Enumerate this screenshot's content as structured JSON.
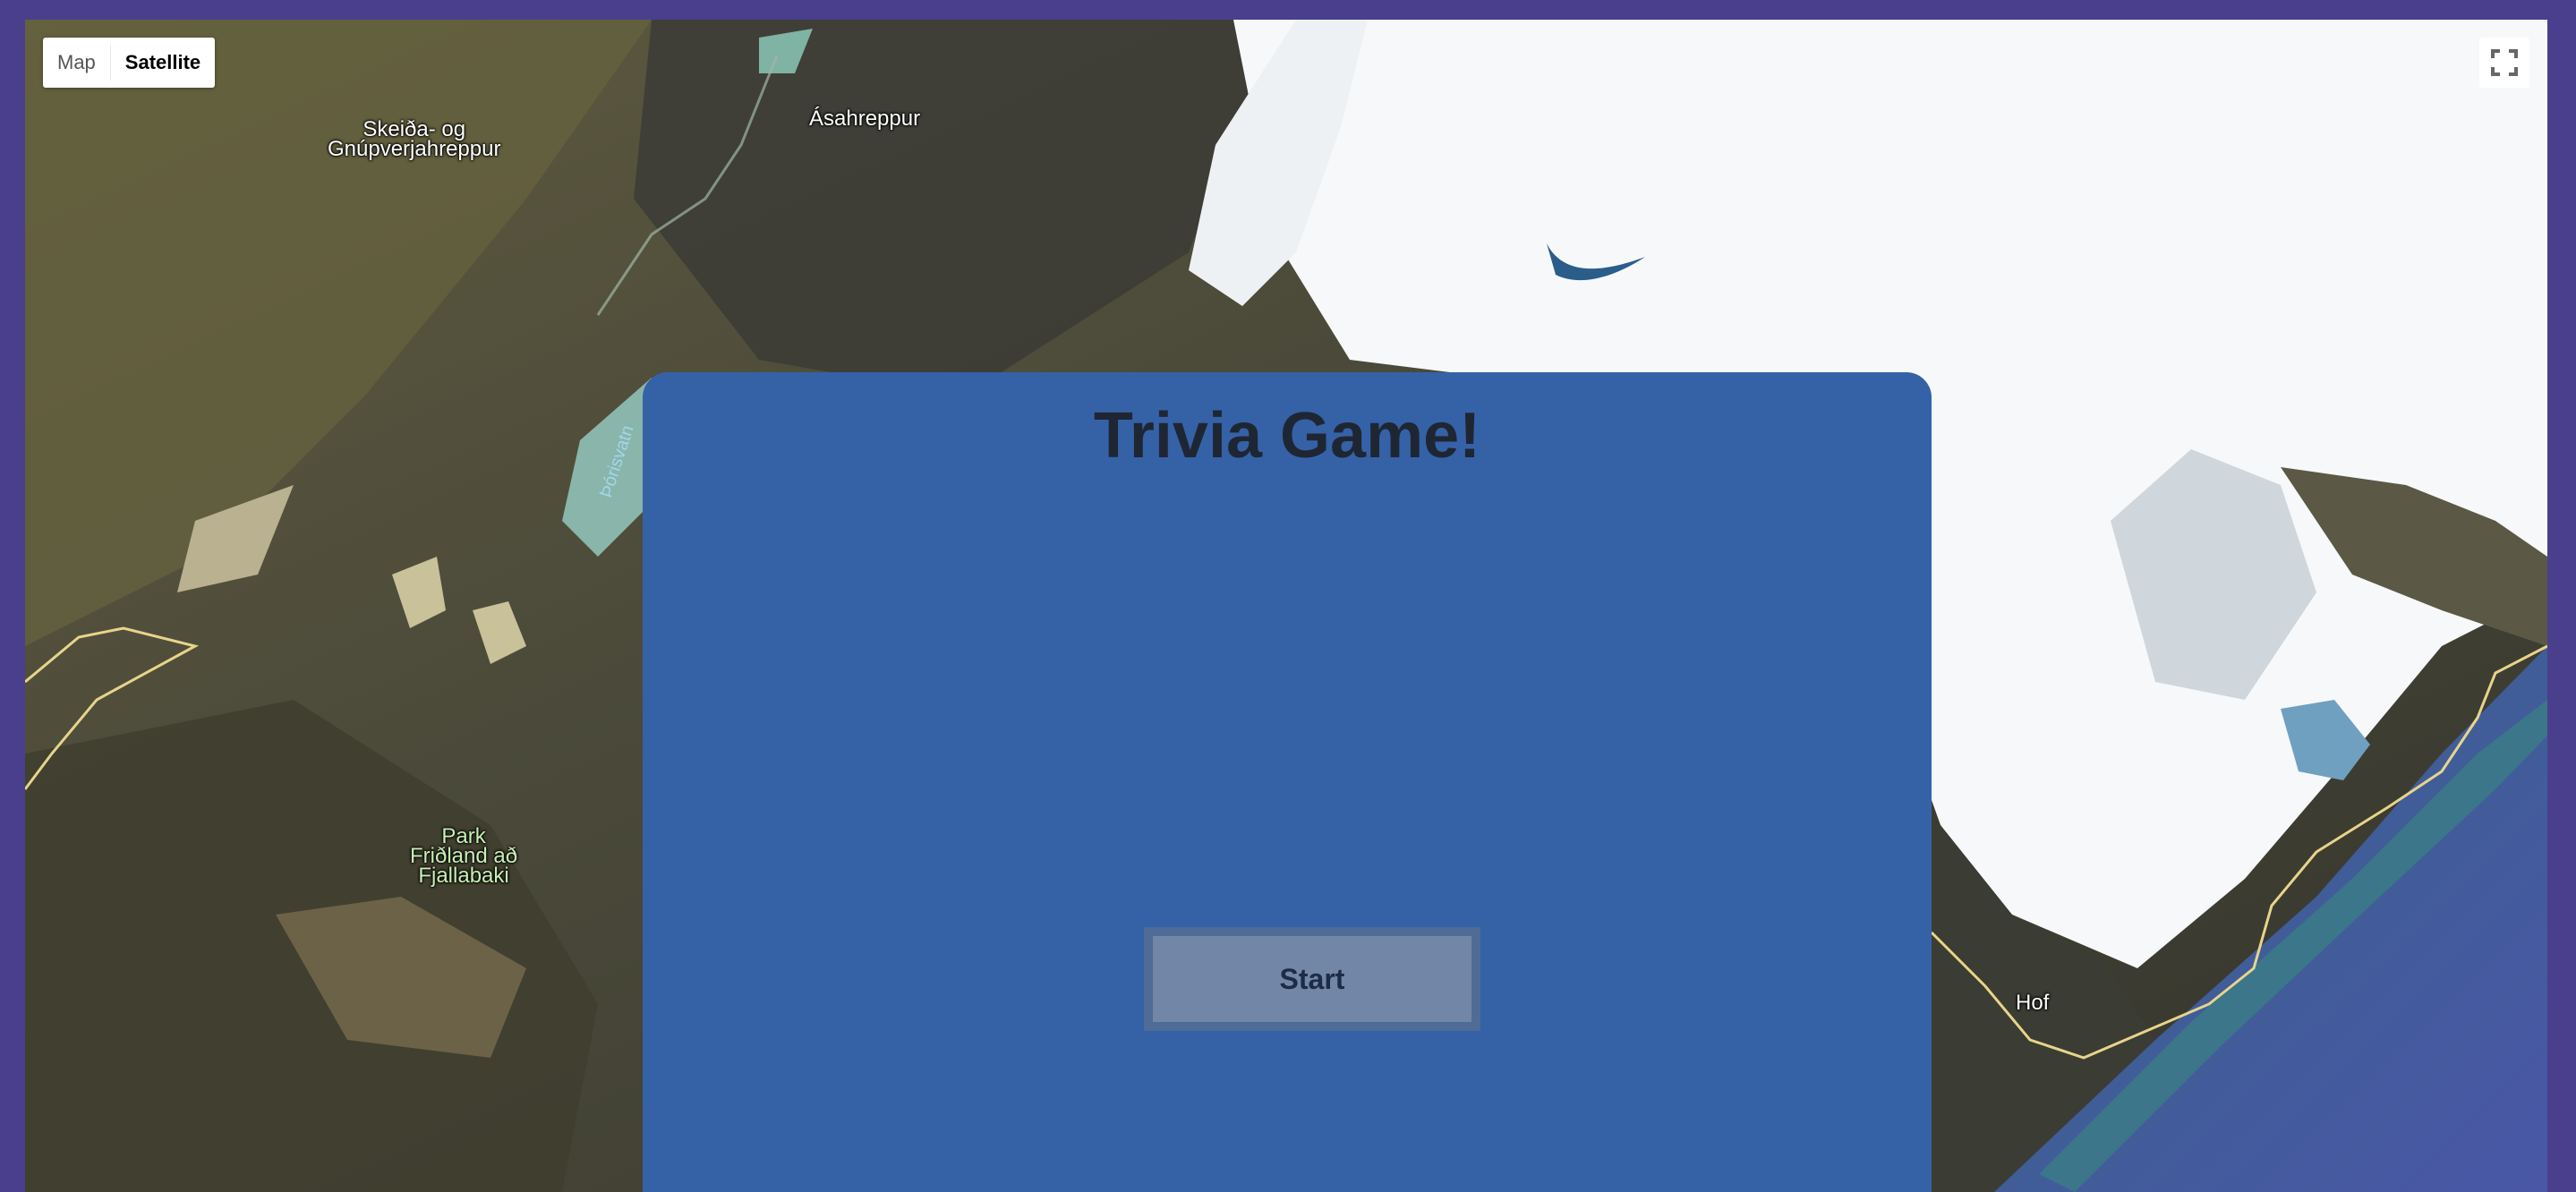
{
  "map": {
    "type_control": {
      "map_label": "Map",
      "satellite_label": "Satellite",
      "selected": "Satellite"
    },
    "fullscreen_icon": "fullscreen-icon",
    "places": {
      "skeida_line1": "Skeiða- og",
      "skeida_line2": "Gnúpverjahreppur",
      "asahreppur": "Ásahreppur",
      "park_line1": "Park",
      "park_line2": "Friðland að",
      "park_line3": "Fjallabaki",
      "hof": "Hof",
      "lake": "Þórisvatn"
    }
  },
  "trivia": {
    "title": "Trivia Game!",
    "start_label": "Start"
  },
  "colors": {
    "page_background": "#4a3f8c",
    "panel": "#3562a7",
    "button_fill": "#7286a8",
    "button_border": "#4f6c96",
    "title_text": "#1f2633"
  }
}
